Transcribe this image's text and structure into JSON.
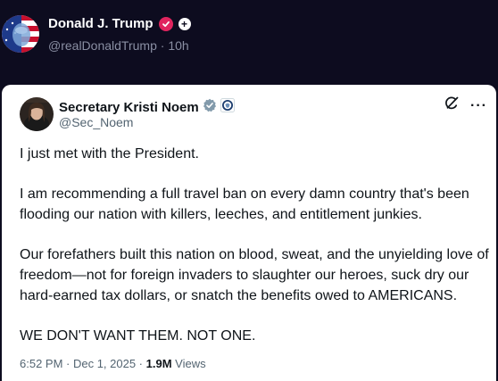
{
  "outer_post": {
    "author_name": "Donald J. Trump",
    "handle": "@realDonaldTrump",
    "separator": "·",
    "time_ago": "10h",
    "plus_badge": "+"
  },
  "quoted_post": {
    "author_name": "Secretary Kristi Noem",
    "handle": "@Sec_Noem",
    "more_label": "···",
    "paragraphs": [
      "I just met with the President.",
      "I am recommending a full travel ban on every damn country that's been flooding our nation with killers, leeches, and entitlement junkies.",
      "Our forefathers built this nation on blood, sweat, and the unyielding love of freedom—not for foreign invaders to slaughter our heroes, suck dry our hard-earned tax dollars, or snatch the benefits owed to AMERICANS.",
      "WE DON'T WANT THEM. NOT ONE."
    ],
    "timestamp": "6:52 PM · Dec 1, 2025 · ",
    "views_count": "1.9M",
    "views_label": " Views"
  },
  "colors": {
    "background": "#0d0c1f",
    "card": "#ffffff",
    "verified_blue": "#1d9bf0",
    "verified_gray": "#829aab",
    "pink_badge": "#e0245e"
  },
  "icons": {
    "outer_verified": "pink-verified-badge-icon",
    "quoted_verified": "gray-verified-badge-icon",
    "affiliate": "dhs-seal-icon",
    "grok": "grok-icon",
    "more": "more-options-icon"
  }
}
